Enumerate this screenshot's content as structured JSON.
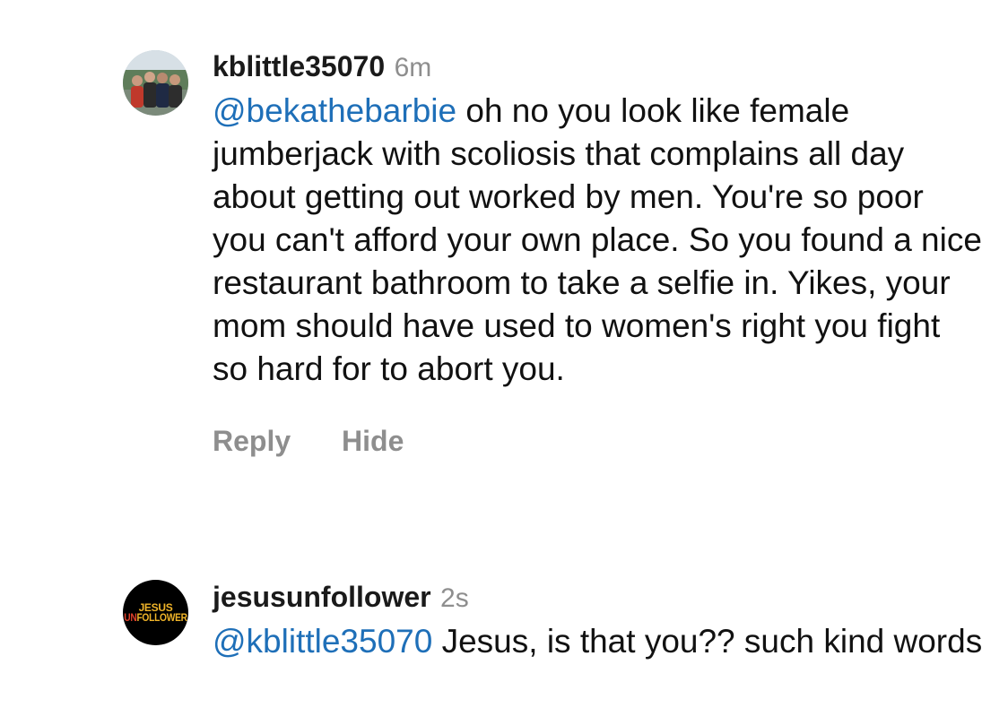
{
  "comments": [
    {
      "username": "kblittle35070",
      "time": "6m",
      "mention": "@bekathebarbie",
      "text": " oh no you look like female jumberjack with scoliosis that complains all day about getting out worked by men. You're so poor you can't afford your own place. So you found a nice restaurant bathroom to take a selfie in. Yikes, your mom should have used to women's right you fight so hard for to abort you.",
      "actions": {
        "reply": "Reply",
        "hide": "Hide"
      }
    },
    {
      "username": "jesusunfollower",
      "time": "2s",
      "mention": "@kblittle35070",
      "text": " Jesus, is that you?? such kind words",
      "avatar_logo": {
        "line1": "JESUS",
        "line2a": "UN",
        "line2b": "FOLLOWER"
      }
    }
  ],
  "colors": {
    "mention": "#1e6fb8",
    "muted": "#8e8e8e",
    "logo_yellow": "#f0b429",
    "logo_red": "#e0402a"
  }
}
